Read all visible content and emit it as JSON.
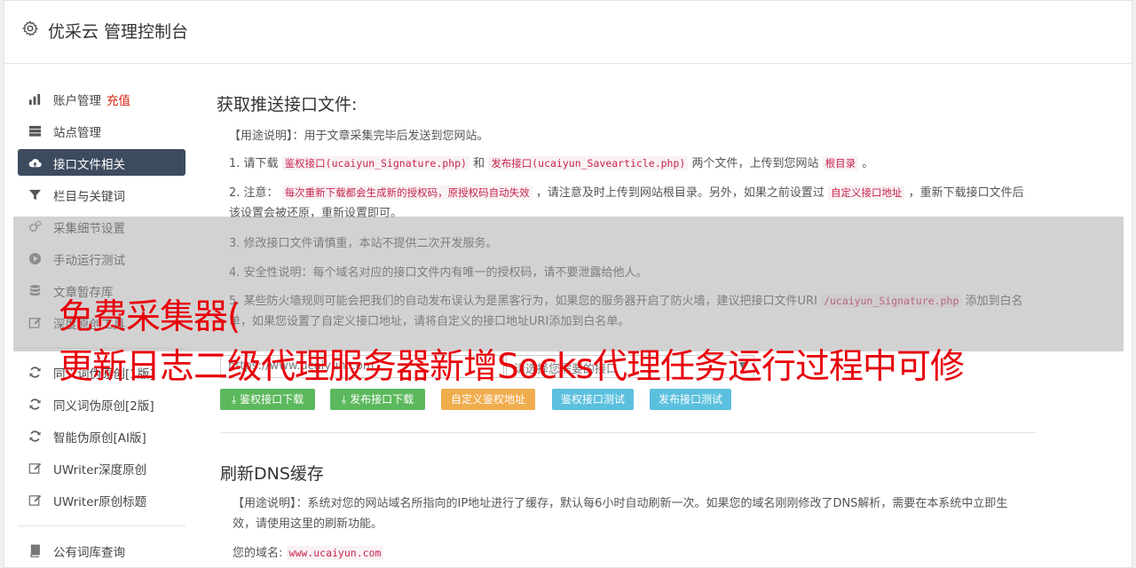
{
  "header": {
    "title": "优采云 管理控制台",
    "icon": "gear-icon"
  },
  "sidebar": {
    "items": [
      {
        "label": "账户管理",
        "badge": "充值",
        "icon": "bar-chart-icon"
      },
      {
        "label": "站点管理",
        "icon": "server-icon"
      },
      {
        "label": "接口文件相关",
        "icon": "cloud-upload-icon",
        "active": true
      },
      {
        "label": "栏目与关键词",
        "icon": "filter-icon"
      },
      {
        "label": "采集细节设置",
        "icon": "cogs-icon"
      },
      {
        "label": "手动运行测试",
        "icon": "play-icon"
      },
      {
        "label": "文章暂存库",
        "icon": "database-icon"
      },
      {
        "label": "深度原创工具",
        "icon": "edit-icon"
      },
      {
        "label": "同义词伪原创[1版]",
        "icon": "refresh-icon"
      },
      {
        "label": "同义词伪原创[2版]",
        "icon": "refresh-icon"
      },
      {
        "label": "智能伪原创[AI版]",
        "icon": "refresh-icon"
      },
      {
        "label": "UWriter深度原创",
        "icon": "edit-icon"
      },
      {
        "label": "UWriter原创标题",
        "icon": "edit-icon"
      },
      {
        "label": "公有词库查询",
        "icon": "book-icon"
      }
    ]
  },
  "section1": {
    "title": "获取推送接口文件:",
    "usage": "【用途说明】：用于文章采集完毕后发送到您网站。",
    "p1": {
      "a": "1. 请下载",
      "code1": "鉴权接口(ucaiyun_Signature.php)",
      "b": "和",
      "code2": "发布接口(ucaiyun_Savearticle.php)",
      "c": "两个文件，上传到您网站",
      "code3": "根目录",
      "d": "。"
    },
    "p2": {
      "a": "2. 注意：",
      "code1": "每次重新下载都会生成新的授权码，原授权码自动失效",
      "b": "，请注意及时上传到网站根目录。另外，如果之前设置过",
      "code2": "自定义接口地址",
      "c": "，重新下载接口文件后该设置会被还原，重新设置即可。"
    },
    "p3": "3. 修改接口文件请慎重，本站不提供二次开发服务。",
    "p4": "4. 安全性说明：每个域名对应的接口文件内有唯一的授权码，请不要泄露给他人。",
    "p5": {
      "a": "5. 某些防火墙规则可能会把我们的自动发布误认为是黑客行为，如果您的服务器开启了防火墙，建议把接口文件URI",
      "code1": "/ucaiyun_Signature.php",
      "b": "添加到白名单，如果您设置了自定义接口地址，请将自定义的接口地址URI添加到白名单。"
    },
    "url_input": "https://www.ucaiyun.com",
    "select_placeholder": "请选择您需要的接口",
    "buttons": {
      "sig_download": "鉴权接口下载",
      "pub_download": "发布接口下载",
      "custom_sig": "自定义鉴权地址",
      "sig_test": "鉴权接口测试",
      "pub_test": "发布接口测试"
    }
  },
  "section2": {
    "title": "刷新DNS缓存",
    "usage": "【用途说明】：系统对您的网站域名所指向的IP地址进行了缓存，默认每6小时自动刷新一次。如果您的域名刚刚修改了DNS解析，需要在本系统中立即生效，请使用这里的刷新功能。",
    "domain_label": "您的域名:",
    "domain_value": "www.ucaiyun.com"
  },
  "overlay": {
    "line1": "免费采集器(",
    "line2": "更新日志二级代理服务器新增Socks代理任务运行过程中可修"
  },
  "colors": {
    "active_nav": "#3d4b5e",
    "green": "#5cb85c",
    "orange": "#f0ad4e",
    "blue": "#5bc0de",
    "overlay_text": "#e8000b"
  }
}
